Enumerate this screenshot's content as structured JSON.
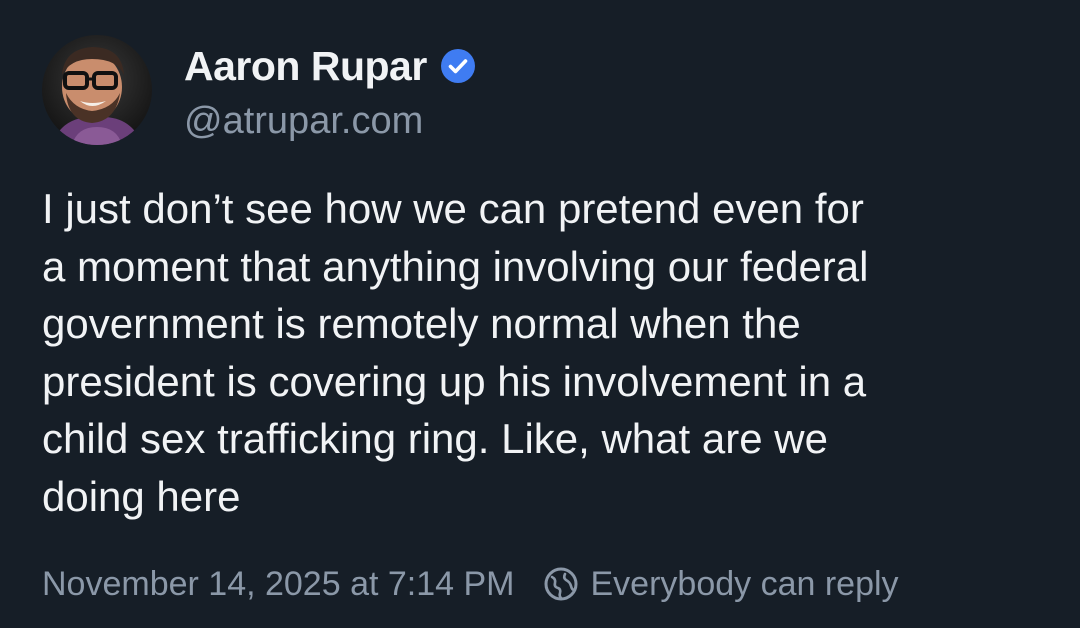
{
  "author": {
    "display_name": "Aaron Rupar",
    "handle": "@atrupar.com",
    "verified": true,
    "avatar_icon": "profile-photo"
  },
  "post": {
    "text": "I just don’t see how we can pretend even for\na moment that anything involving our federal\ngovernment is remotely normal when the\npresident is covering up his involvement in a\nchild sex trafficking ring. Like, what are we\ndoing here",
    "timestamp": "November 14, 2025 at 7:14 PM",
    "reply_setting": "Everybody can reply",
    "reply_setting_icon": "globe-icon"
  },
  "colors": {
    "background": "#161e27",
    "primary_text": "#f1f3f5",
    "secondary_text": "#8b98a8",
    "verified_badge": "#3f7cf2"
  }
}
